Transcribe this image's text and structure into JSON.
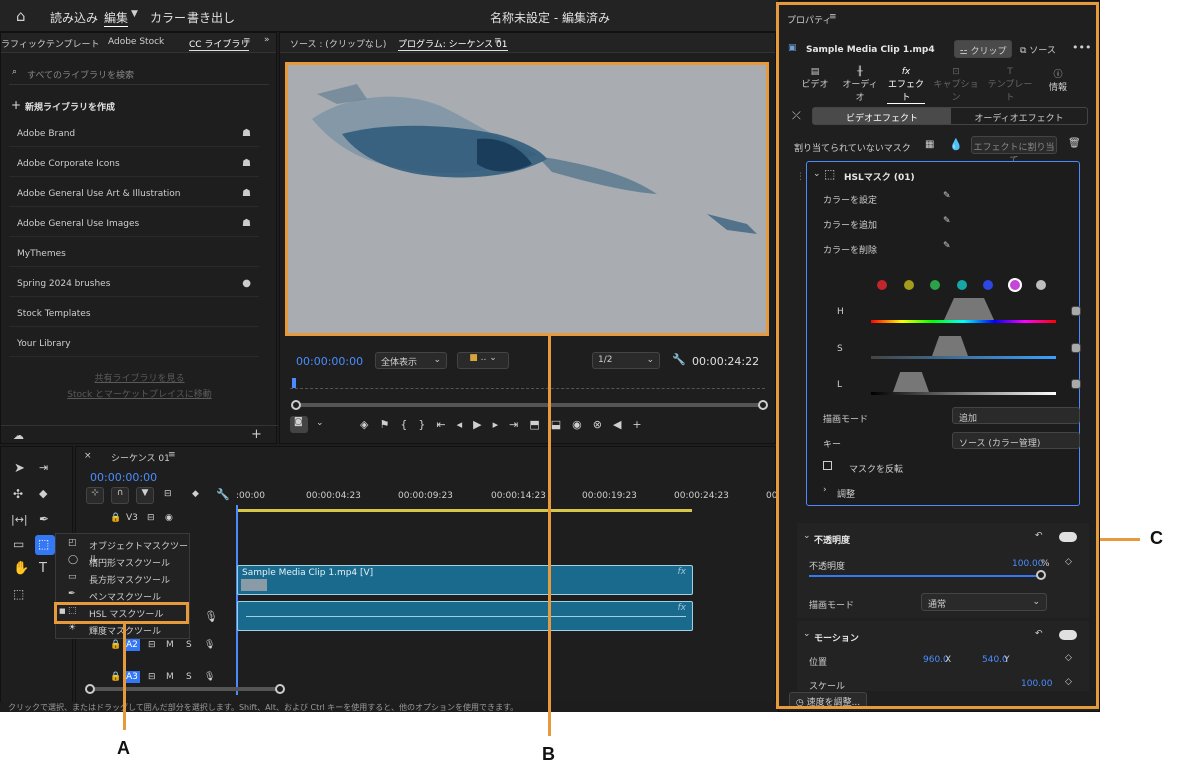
{
  "topbar": {
    "menu": [
      "読み込み",
      "編集",
      "カラー",
      "書き出し"
    ],
    "title": "名称未設定 - 編集済み"
  },
  "library": {
    "tabs": [
      "ラフィックテンプレート",
      "Adobe Stock",
      "CC ライブラリ"
    ],
    "search_placeholder": "すべてのライブラリを検索",
    "create": "新規ライブラリを作成",
    "items": [
      {
        "label": "Adobe Brand",
        "icon": "shared-icon"
      },
      {
        "label": "Adobe Corporate Icons",
        "icon": "shared-icon"
      },
      {
        "label": "Adobe General Use Art & Illustration",
        "icon": "shared-icon"
      },
      {
        "label": "Adobe General Use Images",
        "icon": "shared-icon"
      },
      {
        "label": "MyThemes",
        "icon": ""
      },
      {
        "label": "Spring 2024 brushes",
        "icon": "globe-icon"
      },
      {
        "label": "Stock Templates",
        "icon": ""
      },
      {
        "label": "Your Library",
        "icon": ""
      }
    ],
    "links": [
      "共有ライブラリを見る",
      "Stock とマーケットプレイスに移動"
    ]
  },
  "monitor": {
    "source_tab": "ソース : (クリップなし)",
    "program_tab": "プログラム: シーケンス 01",
    "timecode": "00:00:00:00",
    "fit": "全体表示",
    "resolution": "1/2",
    "duration": "00:00:24:22"
  },
  "timeline": {
    "tab": "シーケンス 01",
    "timecode": "00:00:00:00",
    "ruler": [
      ":00:00",
      "00:00:04:23",
      "00:00:09:23",
      "00:00:14:23",
      "00:00:19:23",
      "00:00:24:23",
      "00:0"
    ],
    "tracks": [
      "V3",
      "A2",
      "A3"
    ],
    "track_flags": [
      "M",
      "S"
    ],
    "clip_label": "Sample Media Clip 1.mp4 [V]",
    "fx": "fx"
  },
  "mask_tools": [
    "オブジェクトマスクツール",
    "楕円形マスクツール",
    "長方形マスクツール",
    "ペンマスクツール",
    "HSL マスクツール",
    "輝度マスクツール"
  ],
  "status": "クリックで選択、またはドラッグして囲んだ部分を選択します。Shift、Alt、および Ctrl キーを使用すると、他のオプションを使用できます。",
  "properties": {
    "header": "プロパティ",
    "clip_name": "Sample Media Clip 1.mp4",
    "clip_btn": "クリップ",
    "source_btn": "ソース",
    "tabs": [
      "ビデオ",
      "オーディオ",
      "エフェクト",
      "キャプション",
      "テンプレート",
      "情報"
    ],
    "effect_tabs": [
      "ビデオエフェクト",
      "オーディオエフェクト"
    ],
    "mask_label": "割り当てられていないマスク",
    "assign_btn": "エフェクトに割り当て",
    "hsl_title": "HSLマスク (01)",
    "hsl_rows": [
      "カラーを設定",
      "カラーを追加",
      "カラーを削除"
    ],
    "channels": [
      "H",
      "S",
      "L"
    ],
    "blend_label": "描画モード",
    "blend_value": "追加",
    "key_label": "キー",
    "key_value": "ソース (カラー管理)",
    "invert": "マスクを反転",
    "adjust": "調整",
    "opacity_title": "不透明度",
    "opacity_label": "不透明度",
    "opacity_value": "100.00",
    "opacity_unit": "%",
    "blend2_label": "描画モード",
    "blend2_value": "通常",
    "motion_title": "モーション",
    "pos_label": "位置",
    "pos_x": "960.0",
    "pos_x_axis": "X",
    "pos_y": "540.0",
    "pos_y_axis": "Y",
    "scale_label": "スケール",
    "scale_value": "100.00",
    "speed_btn": "速度を調整..."
  },
  "swatch_colors": [
    "#c0262b",
    "#a59a1c",
    "#2aa24a",
    "#17a6a6",
    "#2e47e0",
    "#c646d9",
    "#bdbdbd"
  ],
  "callouts": {
    "a": "A",
    "b": "B",
    "c": "C"
  },
  "colors": {
    "accent": "#e69a3c",
    "timecode": "#4a8cff",
    "clip": "#1a6a8e"
  }
}
